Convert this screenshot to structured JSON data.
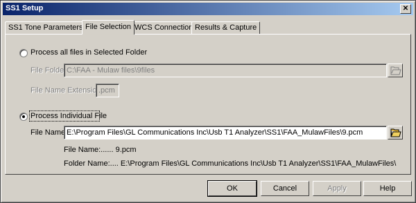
{
  "window": {
    "title": "SS1 Setup",
    "close_glyph": "✕"
  },
  "tabs": [
    {
      "label": "SS1 Tone Parameters"
    },
    {
      "label": "File Selection"
    },
    {
      "label": "WCS Connection"
    },
    {
      "label": "Results & Capture"
    }
  ],
  "active_tab": "File Selection",
  "folder_option": {
    "label": "Process all files in Selected Folder",
    "selected": false,
    "file_folder_label": "File Folder",
    "file_folder_value": "C:\\FAA - Mulaw files\\9files",
    "extension_label": "File Name Extension",
    "extension_value": ".pcm"
  },
  "individual_option": {
    "label": "Process Individual File",
    "selected": true,
    "file_name_label": "File Name",
    "file_name_value": "E:\\Program Files\\GL Communications Inc\\Usb T1 Analyzer\\SS1\\FAA_MulawFiles\\9.pcm",
    "info_file_name": "File Name:...... 9.pcm",
    "info_folder_name": "Folder Name:.... E:\\Program Files\\GL Communications Inc\\Usb T1 Analyzer\\SS1\\FAA_MulawFiles\\"
  },
  "buttons": {
    "ok": "OK",
    "cancel": "Cancel",
    "apply": "Apply",
    "help": "Help"
  },
  "icons": {
    "browse": "folder-open-icon",
    "close": "close-icon"
  }
}
